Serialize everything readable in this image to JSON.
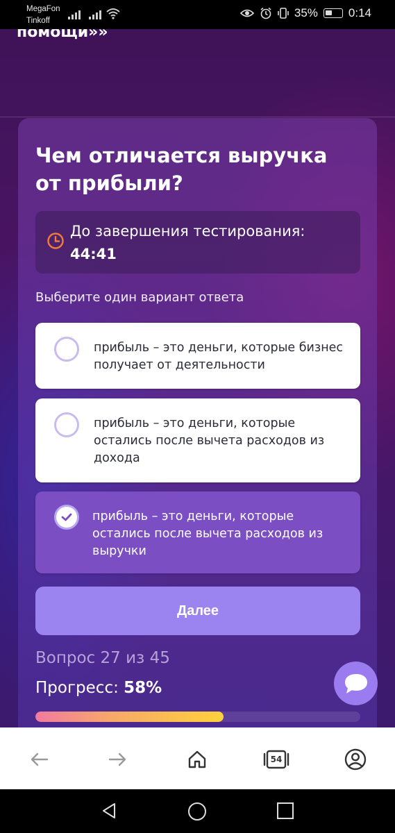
{
  "status_bar": {
    "carrier_1": "MegaFon",
    "carrier_2": "Tinkoff",
    "battery_percent": "35%",
    "time": "0:14"
  },
  "page": {
    "top_text": "помощи»»",
    "question_title": "Чем отличается выручка от прибыли?",
    "timer": {
      "label": "До завершения тестирования:",
      "value": "44:41"
    },
    "instruction": "Выберите один вариант ответа",
    "options": [
      {
        "text": "прибыль – это деньги, которые бизнес получает от деятельности",
        "selected": false
      },
      {
        "text": "прибыль – это деньги, которые остались после вычета расходов из дохода",
        "selected": false
      },
      {
        "text": "прибыль – это деньги, которые остались после вычета расходов из выручки",
        "selected": true
      }
    ],
    "next_button": "Далее",
    "question_counter": "Вопрос 27 из 45",
    "progress_label": "Прогресс:",
    "progress_value": "58%",
    "progress_fraction": 0.58
  },
  "browser_bar": {
    "tabs_count": "54",
    "icons": [
      "back-arrow-icon",
      "forward-arrow-icon",
      "home-icon",
      "tabs-icon",
      "profile-icon"
    ]
  },
  "colors": {
    "accent": "#9c84f0",
    "selected_option": "#7b4fc3",
    "timer_icon": "#f07a3a"
  }
}
